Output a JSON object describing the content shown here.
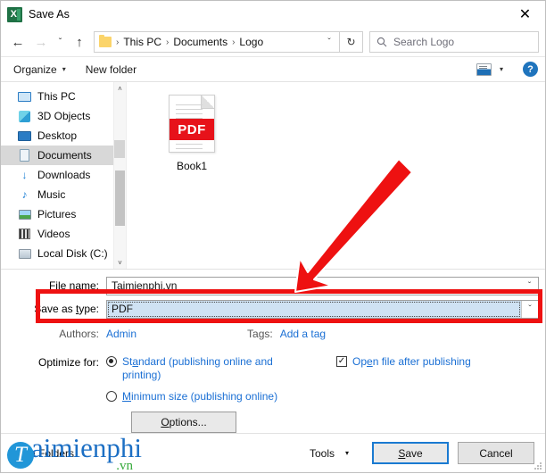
{
  "window": {
    "title": "Save As",
    "app_icon": "excel-icon",
    "close_label": "✕"
  },
  "nav": {
    "back_icon": "←",
    "forward_icon": "→",
    "recent_icon": "ˇ",
    "up_icon": "↑",
    "breadcrumbs": [
      "This PC",
      "Documents",
      "Logo"
    ],
    "separator": "›",
    "dropdown_icon": "ˇ",
    "refresh_icon": "↻",
    "search_placeholder": "Search Logo",
    "search_icon": "⚲"
  },
  "toolbar": {
    "organize_label": "Organize",
    "organize_caret": "▾",
    "new_folder_label": "New folder",
    "view_caret": "▾",
    "help_label": "?"
  },
  "sidebar": {
    "items": [
      {
        "label": "This PC",
        "icon": "pc-icon",
        "selected": false
      },
      {
        "label": "3D Objects",
        "icon": "3d-objects-icon",
        "selected": false
      },
      {
        "label": "Desktop",
        "icon": "desktop-icon",
        "selected": false
      },
      {
        "label": "Documents",
        "icon": "documents-icon",
        "selected": true
      },
      {
        "label": "Downloads",
        "icon": "downloads-icon",
        "selected": false
      },
      {
        "label": "Music",
        "icon": "music-icon",
        "selected": false
      },
      {
        "label": "Pictures",
        "icon": "pictures-icon",
        "selected": false
      },
      {
        "label": "Videos",
        "icon": "videos-icon",
        "selected": false
      },
      {
        "label": "Local Disk (C:)",
        "icon": "disk-icon",
        "selected": false
      }
    ],
    "scroll_up_icon": "˄",
    "scroll_down_icon": "˅"
  },
  "file_list": {
    "files": [
      {
        "name": "Book1",
        "type_badge": "PDF"
      }
    ]
  },
  "form": {
    "file_name_label_pre": "File ",
    "file_name_label_accel": "n",
    "file_name_label_post": "ame:",
    "file_name_value": "Taimienphi.vn",
    "save_as_type_label_pre": "Save as ",
    "save_as_type_label_accel": "t",
    "save_as_type_label_post": "ype:",
    "save_as_type_value": "PDF",
    "caret_icon": "ˇ",
    "authors_label": "Authors:",
    "authors_value": "Admin",
    "tags_label": "Tags:",
    "tags_value": "Add a tag"
  },
  "optimize": {
    "label": "Optimize for:",
    "standard_pre": "St",
    "standard_accel": "a",
    "standard_post": "ndard (publishing online and printing)",
    "standard_selected": true,
    "minimum_pre": "",
    "minimum_accel": "M",
    "minimum_post": "inimum size (publishing online)",
    "minimum_selected": false,
    "open_after_pre": "Op",
    "open_after_accel": "e",
    "open_after_post": "n file after publishing",
    "open_after_checked": true,
    "check_glyph": "✓",
    "options_pre": "",
    "options_accel": "O",
    "options_post": "ptions..."
  },
  "footer": {
    "hide_folders_label": "Hide Folders",
    "tools_label": "Tools",
    "tools_caret": "▾",
    "save_pre": "",
    "save_accel": "S",
    "save_post": "ave",
    "cancel_label": "Cancel"
  },
  "watermark": {
    "initial": "T",
    "main": "aimienphi",
    "domain": ".vn"
  },
  "annotations": {
    "highlight_color": "#ee1111",
    "arrow_color": "#ee1111"
  }
}
